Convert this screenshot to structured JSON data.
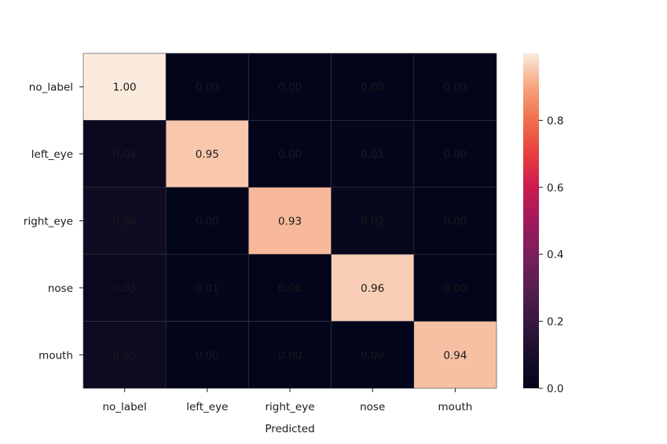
{
  "chart_data": {
    "type": "heatmap",
    "title": "",
    "xlabel": "Predicted",
    "ylabel": "",
    "row_labels": [
      "no_label",
      "left_eye",
      "right_eye",
      "nose",
      "mouth"
    ],
    "col_labels": [
      "no_label",
      "left_eye",
      "right_eye",
      "nose",
      "mouth"
    ],
    "values": [
      [
        1.0,
        0.0,
        0.0,
        0.0,
        0.0
      ],
      [
        0.04,
        0.95,
        0.0,
        0.01,
        0.0
      ],
      [
        0.06,
        0.0,
        0.93,
        0.02,
        0.0
      ],
      [
        0.03,
        0.01,
        0.0,
        0.96,
        0.0
      ],
      [
        0.05,
        0.0,
        0.0,
        0.0,
        0.94
      ]
    ],
    "annotation_format": "0.00",
    "colormap": "rocket",
    "colorbar": {
      "vmin": 0.0,
      "vmax": 1.0,
      "ticks": [
        0.0,
        0.2,
        0.4,
        0.6,
        0.8
      ],
      "tick_labels": [
        "0.0",
        "0.2",
        "0.4",
        "0.6",
        "0.8"
      ],
      "placement": "right"
    },
    "grid": false
  }
}
